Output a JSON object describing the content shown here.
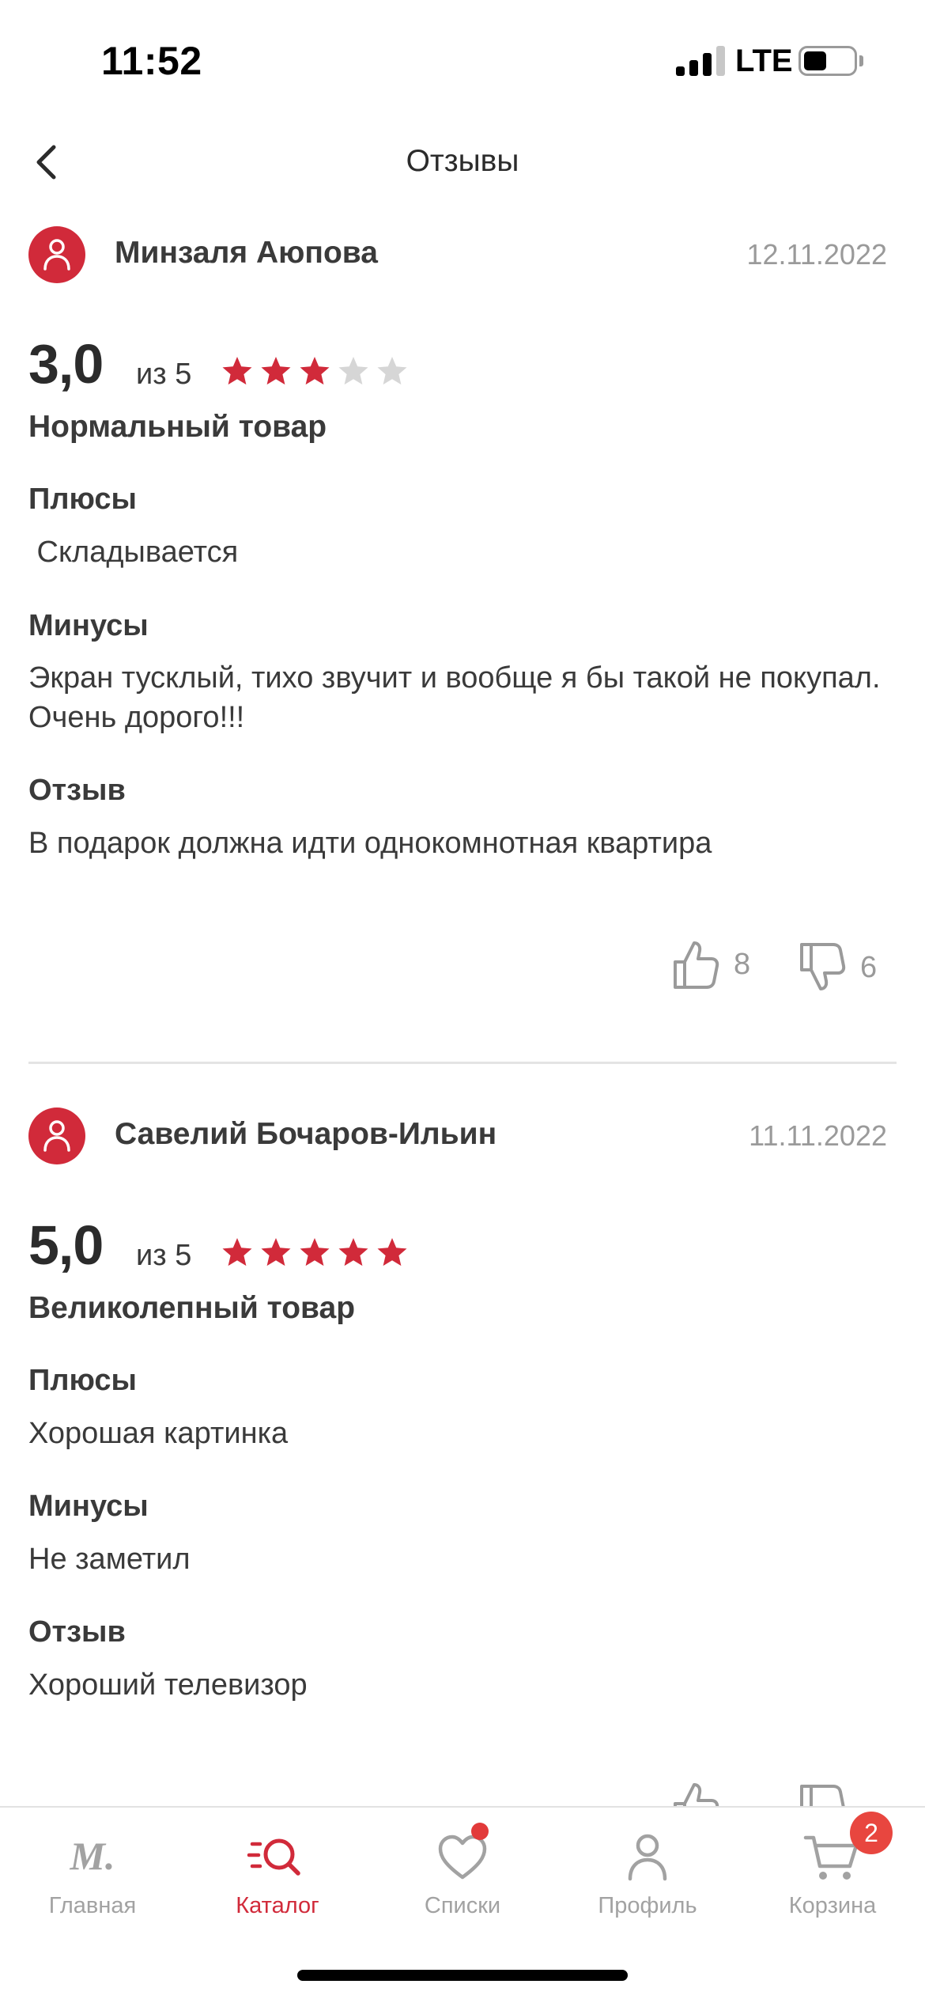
{
  "status_bar": {
    "time": "11:52",
    "network": "LTE",
    "signal_bars_active": 3,
    "signal_bars_total": 4,
    "battery_level": 0.35
  },
  "header": {
    "title": "Отзывы",
    "back_icon": "chevron-left-icon"
  },
  "reviews": [
    {
      "author": "Минзаля Аюпова",
      "date": "12.11.2022",
      "score": "3,0",
      "out_of": "из 5",
      "stars_filled": 3,
      "stars_total": 5,
      "verdict": "Нормальный товар",
      "pros_label": "Плюсы",
      "pros": " Складывается",
      "cons_label": "Минусы",
      "cons": "Экран тусклый, тихо звучит и вообще я бы такой не покупал. Очень дорого!!!",
      "comment_label": "Отзыв",
      "comment": "В подарок должна идти однокомнотная квартира",
      "likes": "8",
      "dislikes": "6"
    },
    {
      "author": "Савелий Бочаров-Ильин",
      "date": "11.11.2022",
      "score": "5,0",
      "out_of": "из 5",
      "stars_filled": 5,
      "stars_total": 5,
      "verdict": "Великолепный товар",
      "pros_label": "Плюсы",
      "pros": "Хорошая картинка",
      "cons_label": "Минусы",
      "cons": "Не заметил",
      "comment_label": "Отзыв",
      "comment": "Хороший телевизор"
    }
  ],
  "tab_bar": {
    "items": [
      {
        "label": "Главная",
        "icon": "m-logo-icon",
        "active": false
      },
      {
        "label": "Каталог",
        "icon": "catalog-search-icon",
        "active": true
      },
      {
        "label": "Списки",
        "icon": "heart-icon",
        "active": false,
        "dot": true
      },
      {
        "label": "Профиль",
        "icon": "person-icon",
        "active": false
      },
      {
        "label": "Корзина",
        "icon": "cart-icon",
        "active": false,
        "badge": "2"
      }
    ]
  },
  "colors": {
    "accent": "#d12a3a",
    "star_empty": "#d6d6d6",
    "muted": "#9a9a9a",
    "badge": "#e8463f"
  }
}
